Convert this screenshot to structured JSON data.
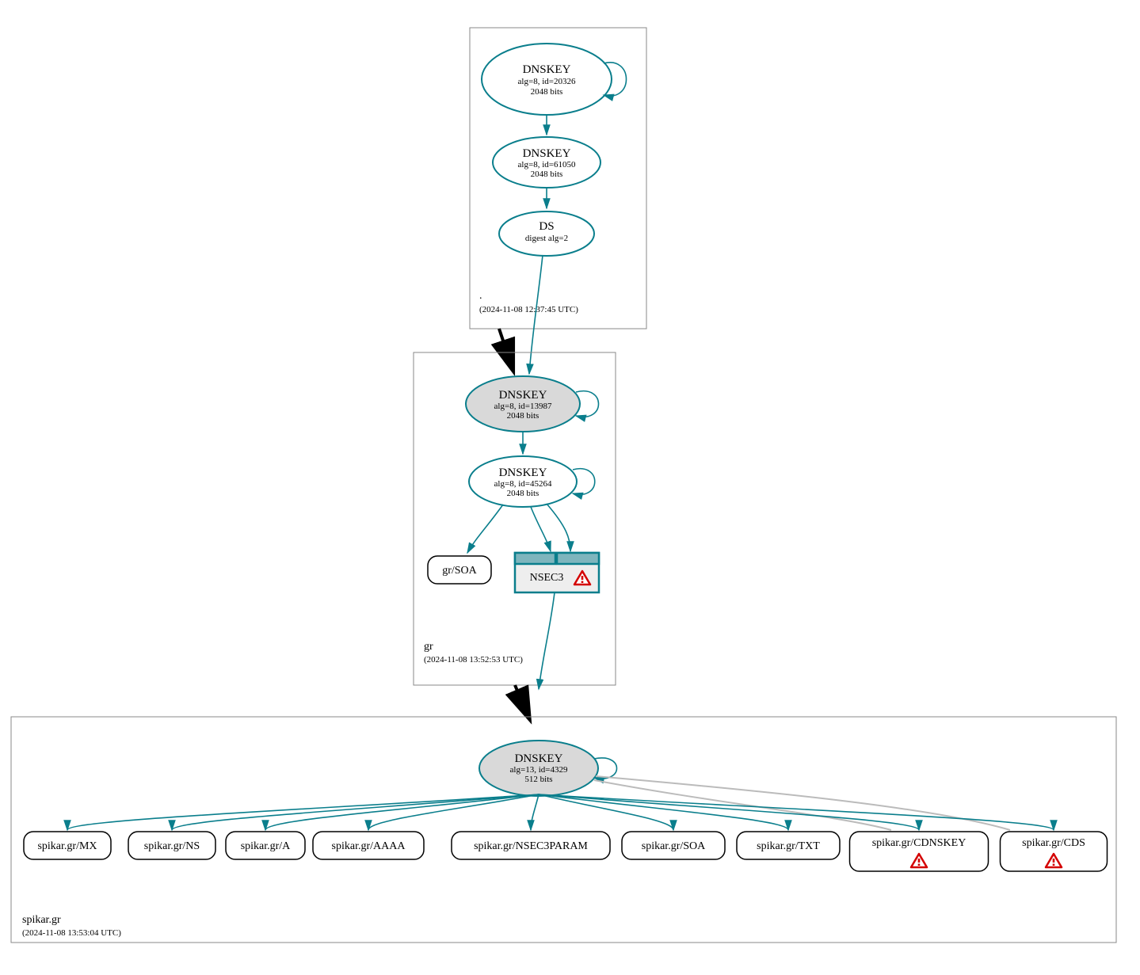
{
  "root": {
    "label": ".",
    "timestamp": "(2024-11-08 12:37:45 UTC)",
    "ksk": {
      "title": "DNSKEY",
      "alg": "alg=8, id=20326",
      "bits": "2048 bits"
    },
    "zsk": {
      "title": "DNSKEY",
      "alg": "alg=8, id=61050",
      "bits": "2048 bits"
    },
    "ds": {
      "title": "DS",
      "digest": "digest alg=2"
    }
  },
  "gr": {
    "label": "gr",
    "timestamp": "(2024-11-08 13:52:53 UTC)",
    "ksk": {
      "title": "DNSKEY",
      "alg": "alg=8, id=13987",
      "bits": "2048 bits"
    },
    "zsk": {
      "title": "DNSKEY",
      "alg": "alg=8, id=45264",
      "bits": "2048 bits"
    },
    "soa": "gr/SOA",
    "nsec3": "NSEC3"
  },
  "spikar": {
    "label": "spikar.gr",
    "timestamp": "(2024-11-08 13:53:04 UTC)",
    "ksk": {
      "title": "DNSKEY",
      "alg": "alg=13, id=4329",
      "bits": "512 bits"
    },
    "records": [
      "spikar.gr/MX",
      "spikar.gr/NS",
      "spikar.gr/A",
      "spikar.gr/AAAA",
      "spikar.gr/NSEC3PARAM",
      "spikar.gr/SOA",
      "spikar.gr/TXT",
      "spikar.gr/CDNSKEY",
      "spikar.gr/CDS"
    ]
  }
}
